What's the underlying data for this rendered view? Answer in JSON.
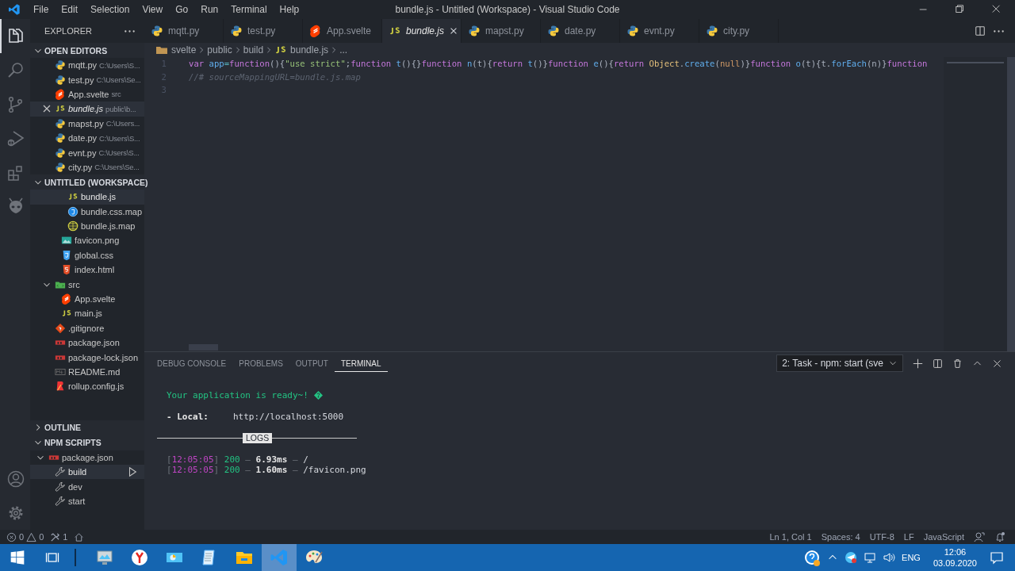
{
  "window": {
    "title": "bundle.js - Untitled (Workspace) - Visual Studio Code"
  },
  "menu": [
    "File",
    "Edit",
    "Selection",
    "View",
    "Go",
    "Run",
    "Terminal",
    "Help"
  ],
  "activity_bar": [
    {
      "kind": "files",
      "selected": true
    },
    {
      "kind": "search",
      "selected": false
    },
    {
      "kind": "source-control",
      "selected": false
    },
    {
      "kind": "run",
      "selected": false
    },
    {
      "kind": "extensions",
      "selected": false
    },
    {
      "kind": "alien",
      "selected": false
    }
  ],
  "activity_bar_bottom": [
    {
      "kind": "account",
      "selected": false
    },
    {
      "kind": "settings",
      "selected": false
    }
  ],
  "sidebar": {
    "title": "EXPLORER",
    "open_editors": {
      "title": "OPEN EDITORS",
      "expanded": true,
      "items": [
        {
          "name": "mqtt.py",
          "path": "C:\\Users\\S...",
          "kind": "python",
          "selected": false,
          "preview": false
        },
        {
          "name": "test.py",
          "path": "C:\\Users\\Se...",
          "kind": "python",
          "selected": false,
          "preview": false
        },
        {
          "name": "App.svelte",
          "path": "src",
          "kind": "svelte",
          "selected": false,
          "preview": false
        },
        {
          "name": "bundle.js",
          "path": "public\\b...",
          "kind": "js",
          "selected": true,
          "preview": true
        },
        {
          "name": "mapst.py",
          "path": "C:\\Users...",
          "kind": "python",
          "selected": false,
          "preview": false
        },
        {
          "name": "date.py",
          "path": "C:\\Users\\S...",
          "kind": "python",
          "selected": false,
          "preview": false
        },
        {
          "name": "evnt.py",
          "path": "C:\\Users\\S...",
          "kind": "python",
          "selected": false,
          "preview": false
        },
        {
          "name": "city.py",
          "path": "C:\\Users\\Se...",
          "kind": "python",
          "selected": false,
          "preview": false
        }
      ]
    },
    "workspace": {
      "title": "UNTITLED (WORKSPACE)",
      "expanded": true,
      "tree": [
        {
          "children": [
            {
              "children": [
                {
                  "name": "bundle.js",
                  "kind": "js",
                  "selected": true
                },
                {
                  "name": "bundle.css.map",
                  "kind": "css-map",
                  "selected": false
                },
                {
                  "name": "bundle.js.map",
                  "kind": "js-map",
                  "selected": false
                }
              ]
            },
            {
              "name": "favicon.png",
              "kind": "image",
              "selected": false
            },
            {
              "name": "global.css",
              "kind": "css",
              "selected": false
            },
            {
              "name": "index.html",
              "kind": "html",
              "selected": false
            }
          ]
        },
        {
          "name": "src",
          "kind": "folder-src",
          "selected": false,
          "expanded": true,
          "children": [
            {
              "name": "App.svelte",
              "kind": "svelte",
              "selected": false
            },
            {
              "name": "main.js",
              "kind": "js",
              "selected": false
            }
          ]
        },
        {
          "name": ".gitignore",
          "kind": "git",
          "selected": false
        },
        {
          "name": "package.json",
          "kind": "npm",
          "selected": false
        },
        {
          "name": "package-lock.json",
          "kind": "npm",
          "selected": false
        },
        {
          "name": "README.md",
          "kind": "markdown",
          "selected": false
        },
        {
          "name": "rollup.config.js",
          "kind": "rollup",
          "selected": false
        }
      ]
    },
    "outline": {
      "title": "OUTLINE",
      "expanded": false
    },
    "npm_scripts": {
      "title": "NPM SCRIPTS",
      "expanded": true,
      "tree": [
        {
          "name": "package.json",
          "kind": "npm",
          "selected": false,
          "expanded": true,
          "children": [
            {
              "name": "build",
              "kind": "script",
              "selected": true
            },
            {
              "name": "dev",
              "kind": "script",
              "selected": false
            },
            {
              "name": "start",
              "kind": "script",
              "selected": false
            }
          ]
        }
      ]
    }
  },
  "editor": {
    "tabs": [
      {
        "name": "mqtt.py",
        "kind": "python",
        "selected": false,
        "preview": false
      },
      {
        "name": "test.py",
        "kind": "python",
        "selected": false,
        "preview": false
      },
      {
        "name": "App.svelte",
        "kind": "svelte",
        "selected": false,
        "preview": false
      },
      {
        "name": "bundle.js",
        "kind": "js",
        "selected": true,
        "preview": true
      },
      {
        "name": "mapst.py",
        "kind": "python",
        "selected": false,
        "preview": false
      },
      {
        "name": "date.py",
        "kind": "python",
        "selected": false,
        "preview": false
      },
      {
        "name": "evnt.py",
        "kind": "python",
        "selected": false,
        "preview": false
      },
      {
        "name": "city.py",
        "kind": "python",
        "selected": false,
        "preview": false
      }
    ],
    "breadcrumb": [
      {
        "text": "svelte",
        "kind": "folder"
      },
      {
        "text": "public"
      },
      {
        "text": "build"
      },
      {
        "text": "bundle.js",
        "kind": "js"
      },
      {
        "text": "..."
      }
    ],
    "lines": [
      {
        "number": "1",
        "tokens": [
          {
            "text": "var ",
            "kind": "keyword"
          },
          {
            "text": "app",
            "kind": "name"
          },
          {
            "text": "=",
            "kind": "op"
          },
          {
            "text": "function",
            "kind": "keyword"
          },
          {
            "text": "(){",
            "kind": "plain"
          },
          {
            "text": "\"use strict\"",
            "kind": "string"
          },
          {
            "text": ";",
            "kind": "plain"
          },
          {
            "text": "function ",
            "kind": "keyword"
          },
          {
            "text": "t",
            "kind": "name"
          },
          {
            "text": "(){}",
            "kind": "plain"
          },
          {
            "text": "function ",
            "kind": "keyword"
          },
          {
            "text": "n",
            "kind": "name"
          },
          {
            "text": "(t){",
            "kind": "plain"
          },
          {
            "text": "return ",
            "kind": "keyword"
          },
          {
            "text": "t",
            "kind": "name"
          },
          {
            "text": "()}",
            "kind": "plain"
          },
          {
            "text": "function ",
            "kind": "keyword"
          },
          {
            "text": "e",
            "kind": "name"
          },
          {
            "text": "(){",
            "kind": "plain"
          },
          {
            "text": "return ",
            "kind": "keyword"
          },
          {
            "text": "Object",
            "kind": "class"
          },
          {
            "text": ".",
            "kind": "plain"
          },
          {
            "text": "create",
            "kind": "name"
          },
          {
            "text": "(",
            "kind": "plain"
          },
          {
            "text": "null",
            "kind": "value"
          },
          {
            "text": ")}",
            "kind": "plain"
          },
          {
            "text": "function ",
            "kind": "keyword"
          },
          {
            "text": "o",
            "kind": "name"
          },
          {
            "text": "(t){t.",
            "kind": "plain"
          },
          {
            "text": "forEach",
            "kind": "name"
          },
          {
            "text": "(n)}",
            "kind": "plain"
          },
          {
            "text": "function",
            "kind": "keyword"
          }
        ]
      },
      {
        "number": "2",
        "tokens": [
          {
            "text": "//# sourceMappingURL=bundle.js.map",
            "kind": "comment"
          }
        ]
      },
      {
        "number": "3"
      }
    ]
  },
  "panel": {
    "tabs": [
      {
        "label": "DEBUG CONSOLE",
        "selected": false
      },
      {
        "label": "PROBLEMS",
        "selected": false
      },
      {
        "label": "OUTPUT",
        "selected": false
      },
      {
        "label": "TERMINAL",
        "selected": true
      }
    ],
    "terminal_select": "2: Task - npm: start (sve",
    "terminal": [
      {
        "kind": "text",
        "segments": [
          {
            "text": "Your application is ready~!",
            "kind": "message"
          },
          {
            "kind": "missing-glyph"
          }
        ]
      },
      {
        "kind": "text",
        "segments": [
          {
            "text": "- Local:",
            "kind": "label"
          },
          {
            "text": "http://localhost:5000",
            "kind": "url"
          }
        ]
      },
      {
        "kind": "divider",
        "label": "LOGS"
      },
      {
        "kind": "log",
        "segments": [
          {
            "text": "[",
            "kind": "bracket"
          },
          {
            "text": "12:05:05",
            "kind": "time"
          },
          {
            "text": "]",
            "kind": "bracket"
          },
          {
            "text": " 200",
            "kind": "status"
          },
          {
            "text": " — ",
            "kind": "dash"
          },
          {
            "text": "6.93ms",
            "kind": "duration"
          },
          {
            "text": " — ",
            "kind": "dash"
          },
          {
            "text": "/",
            "kind": "url"
          }
        ]
      },
      {
        "kind": "log",
        "segments": [
          {
            "text": "[",
            "kind": "bracket"
          },
          {
            "text": "12:05:05",
            "kind": "time"
          },
          {
            "text": "]",
            "kind": "bracket"
          },
          {
            "text": " 200",
            "kind": "status"
          },
          {
            "text": " — ",
            "kind": "dash"
          },
          {
            "text": "1.60ms",
            "kind": "duration"
          },
          {
            "text": " — ",
            "kind": "dash"
          },
          {
            "text": "/favicon.png",
            "kind": "url"
          }
        ]
      }
    ]
  },
  "status_bar": {
    "errors": "0",
    "warnings": "0",
    "tasks": "1",
    "right": [
      "Ln 1, Col 1",
      "Spaces: 4",
      "UTF-8",
      "LF",
      "JavaScript"
    ]
  },
  "taskbar": {
    "apps": [
      {
        "kind": "monitor",
        "selected": false
      },
      {
        "kind": "browser",
        "selected": false
      },
      {
        "kind": "photos",
        "selected": false
      },
      {
        "kind": "notepad",
        "selected": false
      },
      {
        "kind": "folder",
        "selected": false
      },
      {
        "kind": "vscode",
        "selected": true
      },
      {
        "kind": "palette",
        "selected": false
      }
    ],
    "language": "ENG",
    "time": "12:06",
    "date": "03.09.2020"
  }
}
